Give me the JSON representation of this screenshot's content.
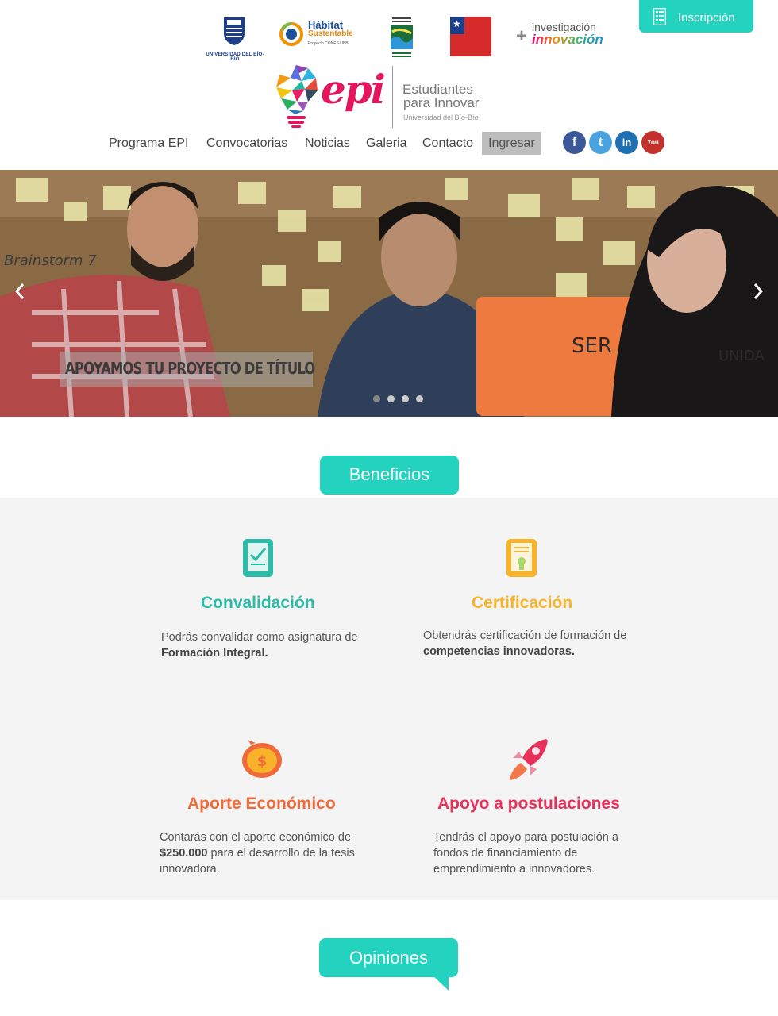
{
  "header": {
    "logos": {
      "ubb": "UNIVERSIDAD DEL BÍO-BÍO",
      "habitat_line1": "Hábitat",
      "habitat_line2": "Sustentable",
      "habitat_line3": "Proyecto CONES UBB",
      "investigacion": "investigación",
      "innovacion": "innovación"
    },
    "inscripcion_label": "Inscripción",
    "brand": {
      "word": "epi",
      "line1": "Estudiantes",
      "line2": "para Innovar",
      "line3": "Universidad del Bío-Bío"
    },
    "nav": [
      {
        "label": "Programa EPI"
      },
      {
        "label": "Convocatorias"
      },
      {
        "label": "Noticias"
      },
      {
        "label": "Galeria"
      },
      {
        "label": "Contacto"
      },
      {
        "label": "Ingresar"
      }
    ],
    "social": [
      {
        "icon": "facebook-icon",
        "glyph": "f",
        "color": "#3b5998"
      },
      {
        "icon": "twitter-icon",
        "glyph": "t",
        "color": "#4aa3df"
      },
      {
        "icon": "linkedin-icon",
        "glyph": "in",
        "color": "#1f6fb2"
      },
      {
        "icon": "youtube-icon",
        "glyph": "You",
        "color": "#c4302b"
      }
    ]
  },
  "slider": {
    "caption": "APOYAMOS TU PROYECTO DE TÍTULO",
    "slide_count": 4,
    "active_slide": 1
  },
  "benefits": {
    "title": "Beneficios",
    "items": [
      {
        "title": "Convalidación",
        "text_pre": "Podrás convalidar como asignatura de ",
        "text_bold": "Formación Integral.",
        "text_post": "",
        "color": "#2bbba6"
      },
      {
        "title": "Certificación",
        "text_pre": "Obtendrás certificación de formación de ",
        "text_bold": "competencias innovadoras.",
        "text_post": "",
        "color": "#f8b32b"
      },
      {
        "title": "Aporte Económico",
        "text_pre": "Contarás con el aporte económico de ",
        "text_bold": "$250.000",
        "text_post": " para el desarrollo de la tesis innovadora.",
        "color": "#f26a3a"
      },
      {
        "title": "Apoyo a postulaciones",
        "text_pre": "Tendrás el apoyo para postulación a fondos de financiamiento de emprendimiento a innovadores.",
        "text_bold": "",
        "text_post": "",
        "color": "#e8305a"
      }
    ]
  },
  "opiniones": {
    "title": "Opiniones"
  }
}
